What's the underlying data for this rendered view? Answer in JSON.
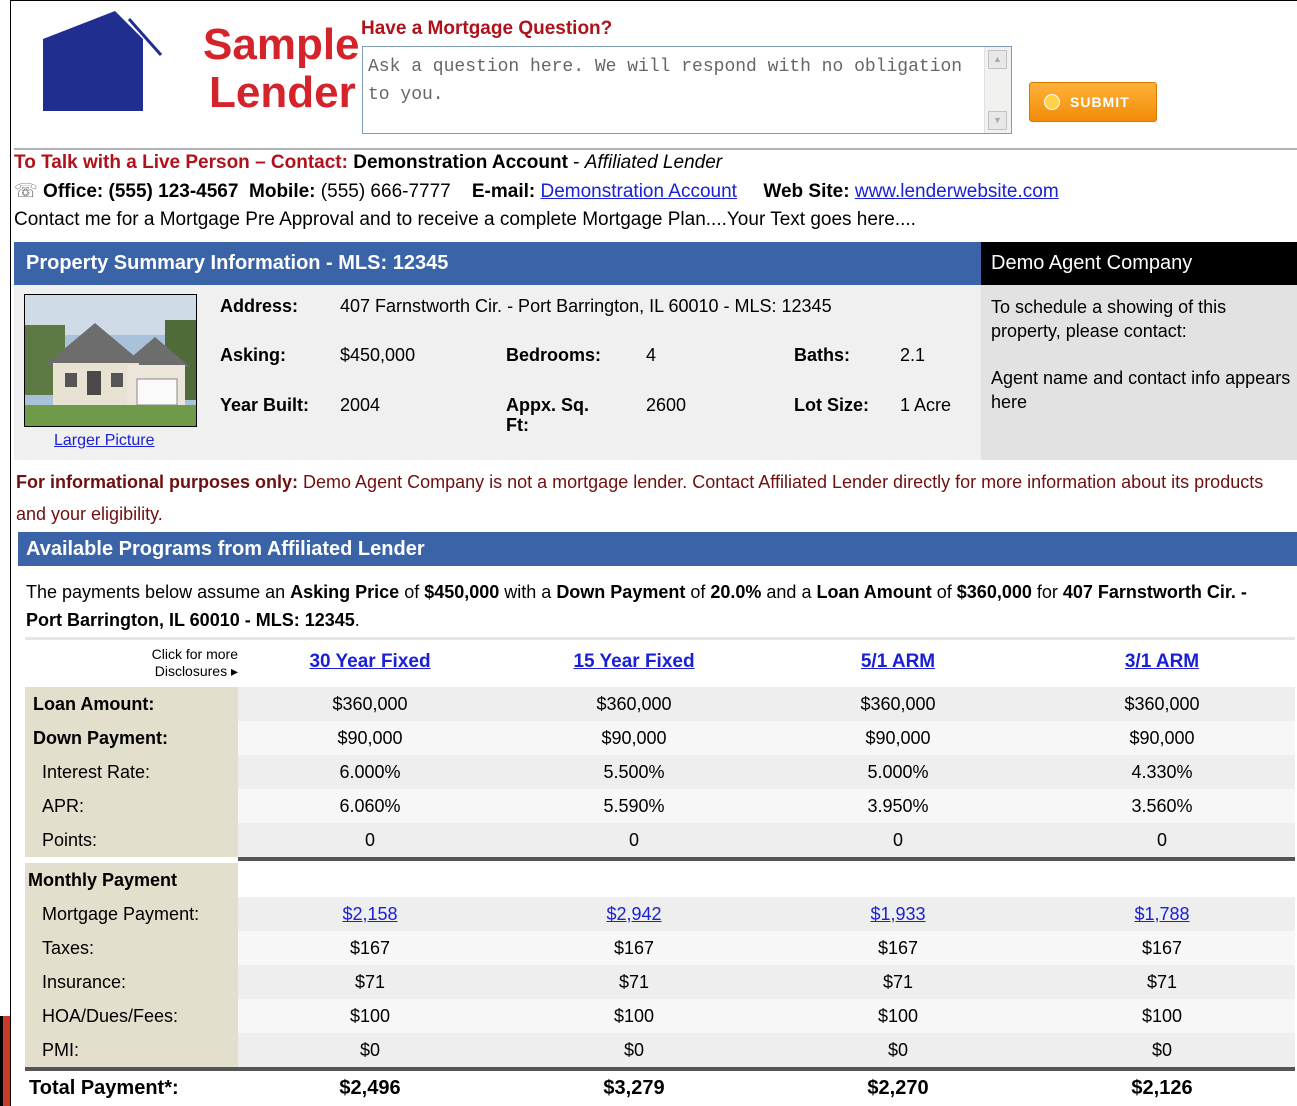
{
  "header": {
    "logo_line1": "Sample",
    "logo_line2": "Lender",
    "question_title": "Have a Mortgage Question?",
    "question_placeholder": "Ask a question here. We will respond with no obligation to you.",
    "submit_label": "SUBMIT"
  },
  "contact": {
    "lead": "To Talk with a Live Person – Contact:",
    "name": "Demonstration Account",
    "affiliation": "Affiliated Lender",
    "office_label": "Office:",
    "office_phone": "(555) 123-4567",
    "mobile_label": "Mobile:",
    "mobile_phone": "(555) 666-7777",
    "email_label": "E-mail:",
    "email_link": "Demonstration Account",
    "web_label": "Web Site:",
    "web_link": "www.lenderwebsite.com",
    "text": "Contact me for a Mortgage Pre Approval and to receive a complete Mortgage Plan....Your Text goes here...."
  },
  "property": {
    "bar_title": "Property Summary Information - MLS: 12345",
    "larger_picture": "Larger Picture",
    "address_label": "Address:",
    "address": "407 Farnstworth Cir. - Port Barrington, IL 60010 - MLS: 12345",
    "asking_label": "Asking:",
    "asking": "$450,000",
    "bedrooms_label": "Bedrooms:",
    "bedrooms": "4",
    "baths_label": "Baths:",
    "baths": "2.1",
    "year_label": "Year Built:",
    "year": "2004",
    "sqft_label": "Appx. Sq. Ft:",
    "sqft": "2600",
    "lot_label": "Lot Size:",
    "lot": "1 Acre"
  },
  "agent": {
    "company": "Demo Agent Company",
    "schedule_text": "To schedule a showing of this property, please contact:",
    "contact_text": "Agent name and contact info appears here"
  },
  "disclaimer": {
    "lead": "For informational purposes only:",
    "text": "Demo Agent Company is not a mortgage lender. Contact Affiliated Lender directly for more information about its products and your eligibility."
  },
  "programs": {
    "bar_title": "Available Programs from Affiliated Lender",
    "assume_p1": "The payments below assume an ",
    "assume_b1": "Asking Price",
    "assume_p2": " of ",
    "assume_b2": "$450,000",
    "assume_p3": " with a ",
    "assume_b3": "Down Payment",
    "assume_p4": " of ",
    "assume_b4": "20.0%",
    "assume_p5": " and a ",
    "assume_b5": "Loan Amount",
    "assume_p6": " of ",
    "assume_b6": "$360,000",
    "assume_p7": " for ",
    "assume_b7": "407 Farnstworth Cir. - Port Barrington, IL 60010 - MLS: 12345",
    "assume_p8": ".",
    "disclosures_line1": "Click for more",
    "disclosures_line2": "Disclosures ▸",
    "columns": [
      "30 Year Fixed",
      "15 Year Fixed",
      "5/1 ARM",
      "3/1 ARM"
    ],
    "loan_amount_label": "Loan Amount:",
    "loan_amount": [
      "$360,000",
      "$360,000",
      "$360,000",
      "$360,000"
    ],
    "down_payment_label": "Down Payment:",
    "down_payment": [
      "$90,000",
      "$90,000",
      "$90,000",
      "$90,000"
    ],
    "interest_rate_label": "Interest Rate:",
    "interest_rate": [
      "6.000%",
      "5.500%",
      "5.000%",
      "4.330%"
    ],
    "apr_label": "APR:",
    "apr": [
      "6.060%",
      "5.590%",
      "3.950%",
      "3.560%"
    ],
    "points_label": "Points:",
    "points": [
      "0",
      "0",
      "0",
      "0"
    ],
    "monthly_label": "Monthly Payment",
    "mortgage_payment_label": "Mortgage Payment:",
    "mortgage_payment": [
      "$2,158",
      "$2,942",
      "$1,933",
      "$1,788"
    ],
    "taxes_label": "Taxes:",
    "taxes": [
      "$167",
      "$167",
      "$167",
      "$167"
    ],
    "insurance_label": "Insurance:",
    "insurance": [
      "$71",
      "$71",
      "$71",
      "$71"
    ],
    "hoa_label": "HOA/Dues/Fees:",
    "hoa": [
      "$100",
      "$100",
      "$100",
      "$100"
    ],
    "pmi_label": "PMI:",
    "pmi": [
      "$0",
      "$0",
      "$0",
      "$0"
    ],
    "total_label": "Total Payment*:",
    "total": [
      "$2,496",
      "$3,279",
      "$2,270",
      "$2,126"
    ]
  },
  "colors": {
    "brand_red": "#d5232c",
    "bar_blue": "#3a63a8",
    "label_beige": "#e2dfcc",
    "submit_orange": "#f28c08",
    "link_blue": "#1a20d6"
  }
}
